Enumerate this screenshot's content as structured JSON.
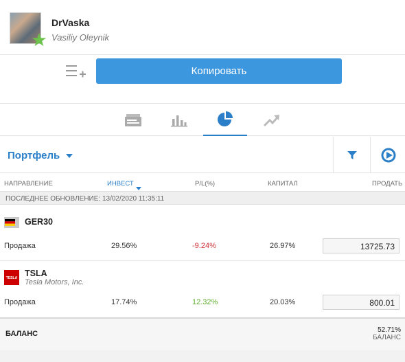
{
  "profile": {
    "username": "DrVaska",
    "full_name": "Vasiliy Oleynik",
    "badge_color": "#6cc24a"
  },
  "copy": {
    "button_label": "Копировать",
    "accent": "#3d97df"
  },
  "tabs": [
    {
      "icon": "news-feed-icon",
      "active": false
    },
    {
      "icon": "bar-chart-icon",
      "active": false
    },
    {
      "icon": "pie-chart-icon",
      "active": true
    },
    {
      "icon": "trend-arrow-icon",
      "active": false
    }
  ],
  "portfolio": {
    "title": "Портфель",
    "filter_icon": "filter-icon",
    "play_icon": "play-circle-icon"
  },
  "columns": {
    "direction": "НАПРАВЛЕНИЕ",
    "invest": "ИНВЕСТ",
    "pl": "P/L(%)",
    "capital": "КАПИТАЛ",
    "sell": "ПРОДАТЬ"
  },
  "update": {
    "text": "ПОСЛЕДНЕЕ ОБНОВЛЕНИЕ: 13/02/2020 11:35:11"
  },
  "instruments": [
    {
      "symbol": "GER30",
      "company": "",
      "flag_icon": "germany-flag-icon",
      "direction": "Продажа",
      "invest": "29.56%",
      "pl": "-9.24%",
      "pl_color": "#d0353a",
      "capital": "26.97%",
      "sell_price": "13725.73"
    },
    {
      "symbol": "TSLA",
      "company": "Tesla Motors, Inc.",
      "flag_icon": "tesla-logo-icon",
      "logo_text": "TESLA",
      "direction": "Продажа",
      "invest": "17.74%",
      "pl": "12.32%",
      "pl_color": "#5fae2c",
      "capital": "20.03%",
      "sell_price": "800.01"
    }
  ],
  "balance": {
    "label": "БАЛАНС",
    "value": "52.71%",
    "sub": "БАЛАНС"
  }
}
